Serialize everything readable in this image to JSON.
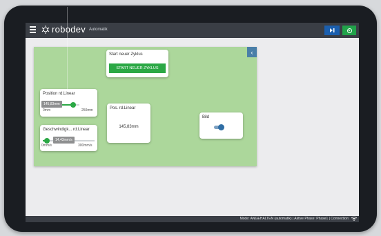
{
  "header": {
    "brand": "robodev",
    "mode": "Automatik",
    "step_icon": "step-forward-icon",
    "run_icon": "run-icon"
  },
  "panel": {
    "collapse_icon": "chevron-left-icon"
  },
  "start_card": {
    "title": "Start neuer Zyklus",
    "button_label": "START NEUER ZYKLUS"
  },
  "position_card": {
    "title": "Position rd.Linear",
    "value_tip": "145,83mm",
    "min": "0mm",
    "max": "250mm",
    "level": 0.58
  },
  "speed_card": {
    "title": "Geschwindigk... rd.Linear",
    "value_tip": "14,43mm/s",
    "min": "0mm/s",
    "max": "300mm/s",
    "level": 0.05
  },
  "pos_value_card": {
    "title": "Pos. rd.Linear",
    "value": "145,83mm"
  },
  "bild_card": {
    "title": "Bild",
    "toggle_on": true
  },
  "status": {
    "text": "Mode: ANGEHALTEN (automatik) | Aktive Phase: Phase1 | Connection:"
  },
  "colors": {
    "accent_green": "#2ba845",
    "primary_blue": "#1b5fae",
    "panel_green": "#acd79b"
  }
}
